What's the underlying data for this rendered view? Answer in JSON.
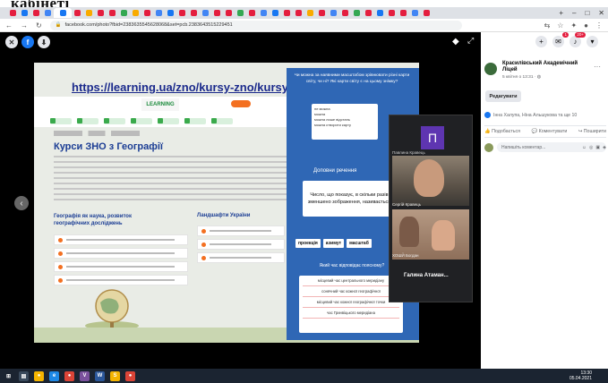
{
  "caption": "кабінеті",
  "browser": {
    "tab_colors": [
      "#e41e3f",
      "#1877f2",
      "#e41e3f",
      "#4285f4",
      "#1877f2",
      "#e41e3f",
      "#f9ab00",
      "#e41e3f",
      "#e41e3f",
      "#34a853",
      "#f9ab00",
      "#e41e3f",
      "#4285f4",
      "#1877f2",
      "#e41e3f",
      "#e41e3f",
      "#4285f4",
      "#e41e3f",
      "#e41e3f",
      "#34a853",
      "#e41e3f",
      "#4285f4",
      "#1877f2",
      "#e41e3f",
      "#e41e3f",
      "#f9ab00",
      "#e41e3f",
      "#4285f4",
      "#e41e3f",
      "#34a853",
      "#e41e3f",
      "#1877f2",
      "#e41e3f",
      "#e41e3f",
      "#4285f4",
      "#e41e3f"
    ],
    "url": "facebook.com/photo?fbid=2383635545628068&set=pcb.2383643515229451",
    "new_tab": "+",
    "window_controls": [
      "–",
      "□",
      "✕"
    ]
  },
  "viewer": {
    "close": "✕",
    "fb": "f",
    "download": "⬇",
    "prev": "‹",
    "next": "›"
  },
  "screenshot": {
    "url_banner": "https://learning.ua/zno/kursy-zno/kursy-zno-z-heohrafii/",
    "logo": "LEARNING",
    "course_title": "Курси ЗНО з Географії",
    "section1": "Географія як наука, розвиток географічних досліджень",
    "section2": "Ландшафти України",
    "quiz": {
      "q1": "Чи можна за наявними масштабом зрівнювати різні карти світу, чи ні? Які карти світу є на цьому знімку?",
      "card1": [
        "не можна",
        "можна",
        "можна лише відстань",
        "можна створити карту"
      ],
      "label2": "Доповни речення",
      "card2": "Число, що показує, в скільки разів зменшено зображення, називається",
      "words": [
        "проекція",
        "азимут",
        "масштаб"
      ],
      "q3": "Який час відповідає поясному?",
      "options": [
        "місцевий час центрального меридіану",
        "сонячний час кожної географічної",
        "місцевий час кожної географічної точки",
        "час Гринвіцького меридіана"
      ]
    }
  },
  "call": {
    "avatar_letter": "П",
    "name1": "Павлина Кравець",
    "name_video1": "Сергій Кравець",
    "name_video2": "ХОШЙ Богдан",
    "name3": "Галина Атаман..."
  },
  "facebook": {
    "page_name": "Красилівський Академічний Ліцей",
    "post_date": "5 квітня о 13:31 · ",
    "edit": "Редагувати",
    "likes": "Інна Халупа, Ніна Альшукова та ще 10",
    "like_action": "Подобається",
    "comment_action": "Коментувати",
    "share_action": "Поширити",
    "comment_placeholder": "Напишіть коментар...",
    "notif_badge": "1",
    "msg_badge": "20+"
  },
  "taskbar": {
    "apps": [
      {
        "label": "⊞",
        "color": "#1b2431"
      },
      {
        "label": "▤",
        "color": "#3a4a5c"
      },
      {
        "label": "●",
        "color": "#f4b400"
      },
      {
        "label": "e",
        "color": "#1e88e5"
      },
      {
        "label": "●",
        "color": "#db4437"
      },
      {
        "label": "V",
        "color": "#7b519d"
      },
      {
        "label": "W",
        "color": "#2b579a"
      },
      {
        "label": "S",
        "color": "#f4b400"
      },
      {
        "label": "●",
        "color": "#db4437"
      }
    ],
    "time": "13:30",
    "date": "05.04.2021"
  }
}
